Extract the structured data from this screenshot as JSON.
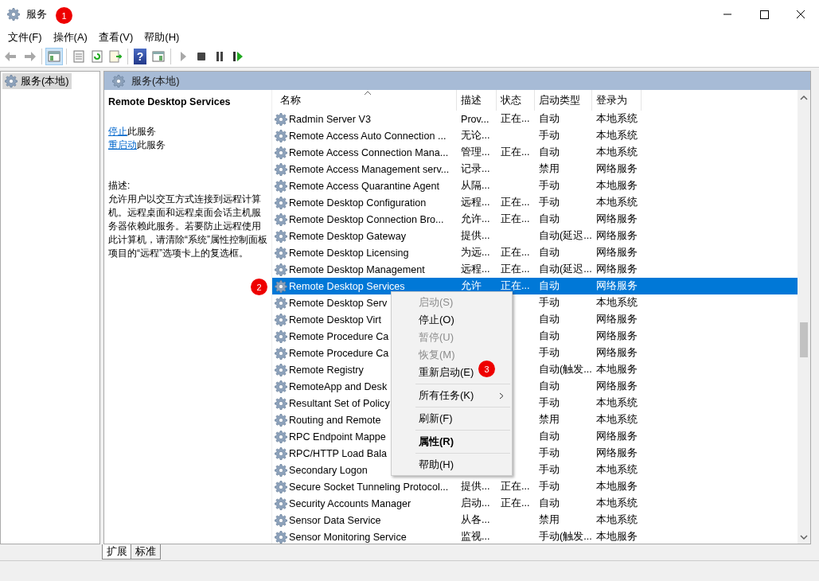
{
  "window": {
    "title": "服务"
  },
  "menu_bar": [
    "文件(F)",
    "操作(A)",
    "查看(V)",
    "帮助(H)"
  ],
  "toolbar": [
    {
      "kind": "back",
      "disabled": true
    },
    {
      "kind": "forward",
      "disabled": true
    },
    {
      "kind": "separator"
    },
    {
      "kind": "tree-toggle",
      "selected": true
    },
    {
      "kind": "separator"
    },
    {
      "kind": "properties",
      "selected": false
    },
    {
      "kind": "refresh",
      "selected": false
    },
    {
      "kind": "export",
      "selected": false
    },
    {
      "kind": "separator"
    },
    {
      "kind": "help",
      "glyph": "?",
      "selected": false
    },
    {
      "kind": "panel",
      "selected": false
    },
    {
      "kind": "separator"
    },
    {
      "kind": "play",
      "disabled": true
    },
    {
      "kind": "stop",
      "disabled": false
    },
    {
      "kind": "pause",
      "disabled": false
    },
    {
      "kind": "resume",
      "disabled": false
    }
  ],
  "tree": {
    "items": [
      {
        "label": "服务(本地)",
        "selected": true
      }
    ]
  },
  "panel": {
    "title": "服务(本地)",
    "detail": {
      "service_name": "Remote Desktop Services",
      "actions": [
        {
          "link": "停止",
          "text": "此服务"
        },
        {
          "link": "重启动",
          "text": "此服务"
        }
      ],
      "description_label": "描述:",
      "description": "允许用户以交互方式连接到远程计算机。远程桌面和远程桌面会话主机服务器依赖此服务。若要防止远程使用此计算机，请清除“系统”属性控制面板项目的“远程”选项卡上的复选框。"
    },
    "table": {
      "columns": [
        "名称",
        "描述",
        "状态",
        "启动类型",
        "登录为"
      ],
      "rows": [
        {
          "name": "Radmin Server V3",
          "description": "Prov...",
          "status": "正在...",
          "startup": "自动",
          "logon": "本地系统",
          "selected": false
        },
        {
          "name": "Remote Access Auto Connection ...",
          "description": "无论...",
          "status": "",
          "startup": "手动",
          "logon": "本地系统",
          "selected": false
        },
        {
          "name": "Remote Access Connection Mana...",
          "description": "管理...",
          "status": "正在...",
          "startup": "自动",
          "logon": "本地系统",
          "selected": false
        },
        {
          "name": "Remote Access Management serv...",
          "description": "记录...",
          "status": "",
          "startup": "禁用",
          "logon": "网络服务",
          "selected": false
        },
        {
          "name": "Remote Access Quarantine Agent",
          "description": "从隔...",
          "status": "",
          "startup": "手动",
          "logon": "本地服务",
          "selected": false
        },
        {
          "name": "Remote Desktop Configuration",
          "description": "远程...",
          "status": "正在...",
          "startup": "手动",
          "logon": "本地系统",
          "selected": false
        },
        {
          "name": "Remote Desktop Connection Bro...",
          "description": "允许...",
          "status": "正在...",
          "startup": "自动",
          "logon": "网络服务",
          "selected": false
        },
        {
          "name": "Remote Desktop Gateway",
          "description": "提供...",
          "status": "",
          "startup": "自动(延迟...",
          "logon": "网络服务",
          "selected": false
        },
        {
          "name": "Remote Desktop Licensing",
          "description": "为远...",
          "status": "正在...",
          "startup": "自动",
          "logon": "网络服务",
          "selected": false
        },
        {
          "name": "Remote Desktop Management",
          "description": "远程...",
          "status": "正在...",
          "startup": "自动(延迟...",
          "logon": "网络服务",
          "selected": false
        },
        {
          "name": "Remote Desktop Services",
          "description": "允许",
          "status": "正在...",
          "startup": "自动",
          "logon": "网络服务",
          "selected": true
        },
        {
          "name": "Remote Desktop Serv",
          "startup": "手动",
          "logon": "本地系统",
          "selected": false
        },
        {
          "name": "Remote Desktop Virt",
          "startup": "自动",
          "logon": "网络服务",
          "selected": false
        },
        {
          "name": "Remote Procedure Ca",
          "startup": "自动",
          "logon": "网络服务",
          "selected": false
        },
        {
          "name": "Remote Procedure Ca",
          "startup": "手动",
          "logon": "网络服务",
          "selected": false
        },
        {
          "name": "Remote Registry",
          "startup": "自动(触发...",
          "logon": "本地服务",
          "selected": false
        },
        {
          "name": "RemoteApp and Desk",
          "startup": "自动",
          "logon": "网络服务",
          "selected": false
        },
        {
          "name": "Resultant Set of Policy",
          "startup": "手动",
          "logon": "本地系统",
          "selected": false
        },
        {
          "name": "Routing and Remote",
          "startup": "禁用",
          "logon": "本地系统",
          "selected": false
        },
        {
          "name": "RPC Endpoint Mappe",
          "startup": "自动",
          "logon": "网络服务",
          "selected": false
        },
        {
          "name": "RPC/HTTP Load Bala",
          "startup": "手动",
          "logon": "网络服务",
          "selected": false
        },
        {
          "name": "Secondary Logon",
          "startup": "手动",
          "logon": "本地系统",
          "selected": false
        },
        {
          "name": "Secure Socket Tunneling Protocol...",
          "description": "提供...",
          "status": "正在...",
          "startup": "手动",
          "logon": "本地服务",
          "selected": false
        },
        {
          "name": "Security Accounts Manager",
          "description": "启动...",
          "status": "正在...",
          "startup": "自动",
          "logon": "本地系统",
          "selected": false
        },
        {
          "name": "Sensor Data Service",
          "description": "从各...",
          "status": "",
          "startup": "禁用",
          "logon": "本地系统",
          "selected": false
        },
        {
          "name": "Sensor Monitoring Service",
          "description": "监视...",
          "status": "",
          "startup": "手动(触发...",
          "logon": "本地服务",
          "selected": false
        }
      ]
    },
    "tabs": [
      {
        "label": "扩展",
        "selected": true
      },
      {
        "label": "标准",
        "selected": false
      }
    ]
  },
  "context_menu": [
    {
      "kind": "item",
      "label": "启动(S)",
      "disabled": true,
      "default": false
    },
    {
      "kind": "item",
      "label": "停止(O)",
      "disabled": false,
      "default": false
    },
    {
      "kind": "item",
      "label": "暂停(U)",
      "disabled": true,
      "default": false
    },
    {
      "kind": "item",
      "label": "恢复(M)",
      "disabled": true,
      "default": false
    },
    {
      "kind": "item",
      "label": "重新启动(E)",
      "disabled": false,
      "default": false
    },
    {
      "kind": "separator"
    },
    {
      "kind": "submenu",
      "label": "所有任务(K)",
      "disabled": false,
      "default": false
    },
    {
      "kind": "separator"
    },
    {
      "kind": "item",
      "label": "刷新(F)",
      "disabled": false,
      "default": false
    },
    {
      "kind": "separator"
    },
    {
      "kind": "item",
      "label": "属性(R)",
      "disabled": false,
      "default": true
    },
    {
      "kind": "separator"
    },
    {
      "kind": "item",
      "label": "帮助(H)",
      "disabled": false,
      "default": false
    }
  ],
  "annotations": [
    {
      "label": "1"
    },
    {
      "label": "2"
    },
    {
      "label": "3"
    }
  ]
}
